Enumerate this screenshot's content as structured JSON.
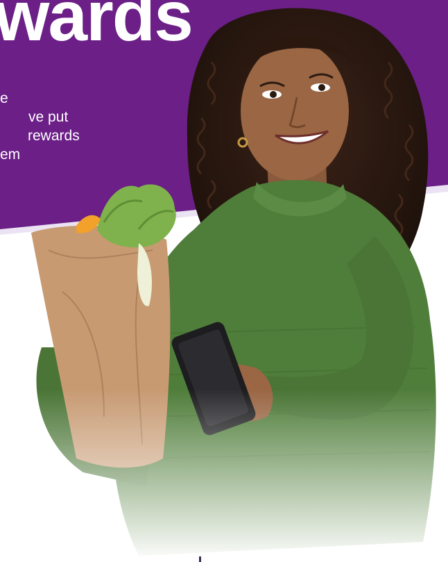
{
  "hero": {
    "headline": "wards",
    "subtext_lines": [
      "e",
      "ve put",
      "rewards",
      "em"
    ]
  },
  "photo": {
    "alt": "Woman in green sweater holding a grocery bag and a smartphone"
  },
  "colors": {
    "purple": "#6b1f87",
    "lavender": "#ebe3f3",
    "sweater": "#4f7d3a",
    "bag": "#c79a72"
  }
}
